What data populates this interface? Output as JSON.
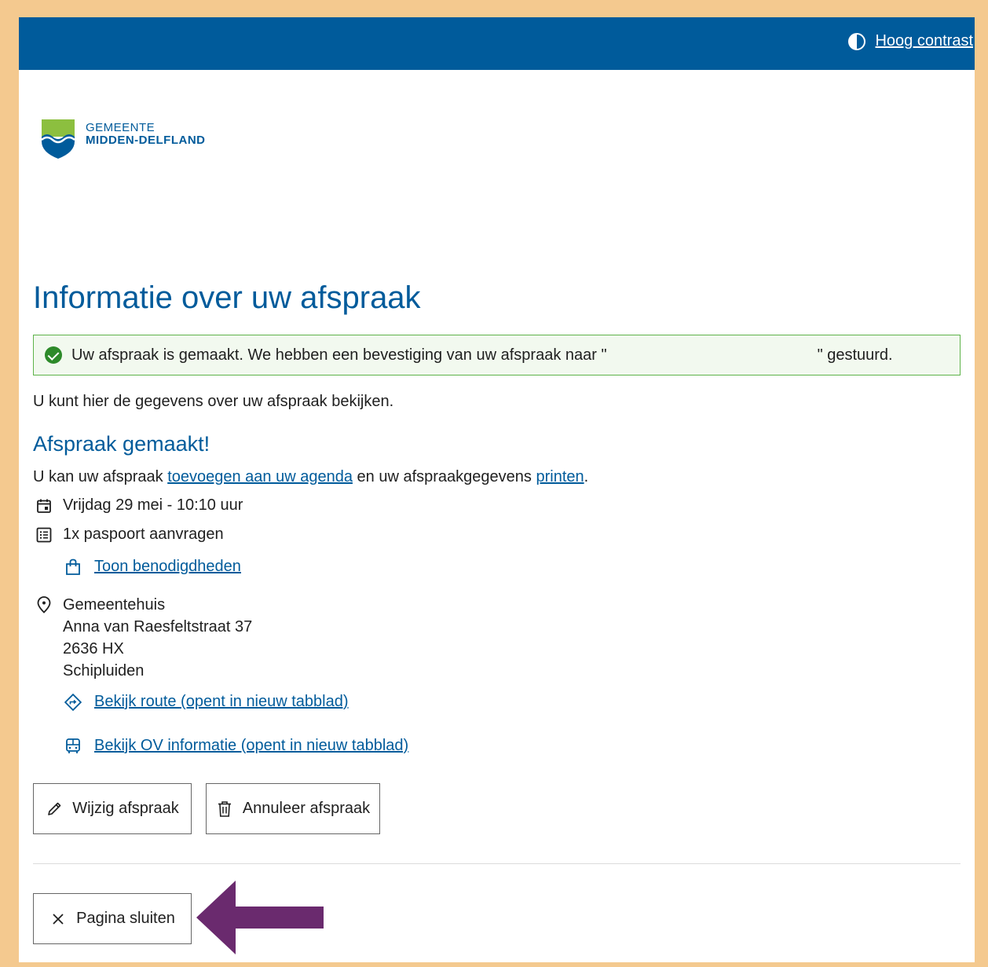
{
  "topbar": {
    "contrast_label": "Hoog contrast"
  },
  "logo": {
    "line1": "GEMEENTE",
    "line2": "MIDDEN-DELFLAND"
  },
  "page": {
    "title": "Informatie over uw afspraak",
    "success_part1": "Uw afspraak is gemaakt. We hebben een bevestiging van uw afspraak naar \"",
    "success_part2": "\" gestuurd.",
    "intro": "U kunt hier de gegevens over uw afspraak bekijken."
  },
  "appointment": {
    "section_title": "Afspraak gemaakt!",
    "agenda_prefix": "U kan uw afspraak ",
    "agenda_link": "toevoegen aan uw agenda",
    "agenda_middle": " en uw afspraakgegevens ",
    "print_link": "printen",
    "agenda_suffix": ".",
    "datetime": "Vrijdag 29 mei - 10:10 uur",
    "product": "1x paspoort aanvragen",
    "requirements_link": "Toon benodigdheden",
    "location": {
      "name": "Gemeentehuis",
      "street": "Anna van Raesfeltstraat 37",
      "postcode": "2636 HX",
      "city": "Schipluiden"
    },
    "route_link": "Bekijk route (opent in nieuw tabblad)",
    "ov_link": "Bekijk OV informatie (opent in nieuw tabblad)"
  },
  "actions": {
    "edit_label": "Wijzig afspraak",
    "cancel_label": "Annuleer afspraak",
    "close_label": "Pagina sluiten"
  },
  "colors": {
    "brand_blue": "#005b9b",
    "success_green": "#5eb34a",
    "frame_border": "#f4c98f",
    "annotation_arrow": "#6a2a6e"
  }
}
